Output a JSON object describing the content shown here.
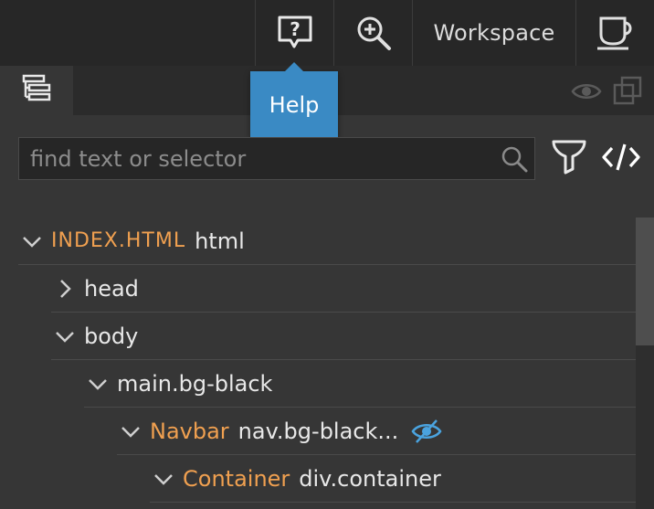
{
  "toolbar": {
    "help_icon": "help-bubble-icon",
    "zoom_icon": "zoom-in-icon",
    "workspace_label": "Workspace",
    "coffee_icon": "coffee-cup-icon"
  },
  "tooltip": {
    "text": "Help"
  },
  "tabs": {
    "active_icon": "tree-structure-icon",
    "eye_icon": "eye-icon",
    "duplicate_icon": "duplicate-icon"
  },
  "search": {
    "placeholder": "find text or selector",
    "value": ""
  },
  "tools": {
    "filter_icon": "funnel-icon",
    "code_icon": "code-icon"
  },
  "tree": {
    "file_name": "INDEX.HTML",
    "rows": [
      {
        "label": "html"
      },
      {
        "label": "head"
      },
      {
        "label": "body"
      },
      {
        "label": "main.bg-black"
      },
      {
        "component": "Navbar",
        "label": "nav.bg-black..."
      },
      {
        "component": "Container",
        "label": "div.container"
      }
    ]
  },
  "colors": {
    "accent": "#3a8ac4",
    "component": "#f0a050",
    "hidden_eye": "#4aa3df"
  }
}
